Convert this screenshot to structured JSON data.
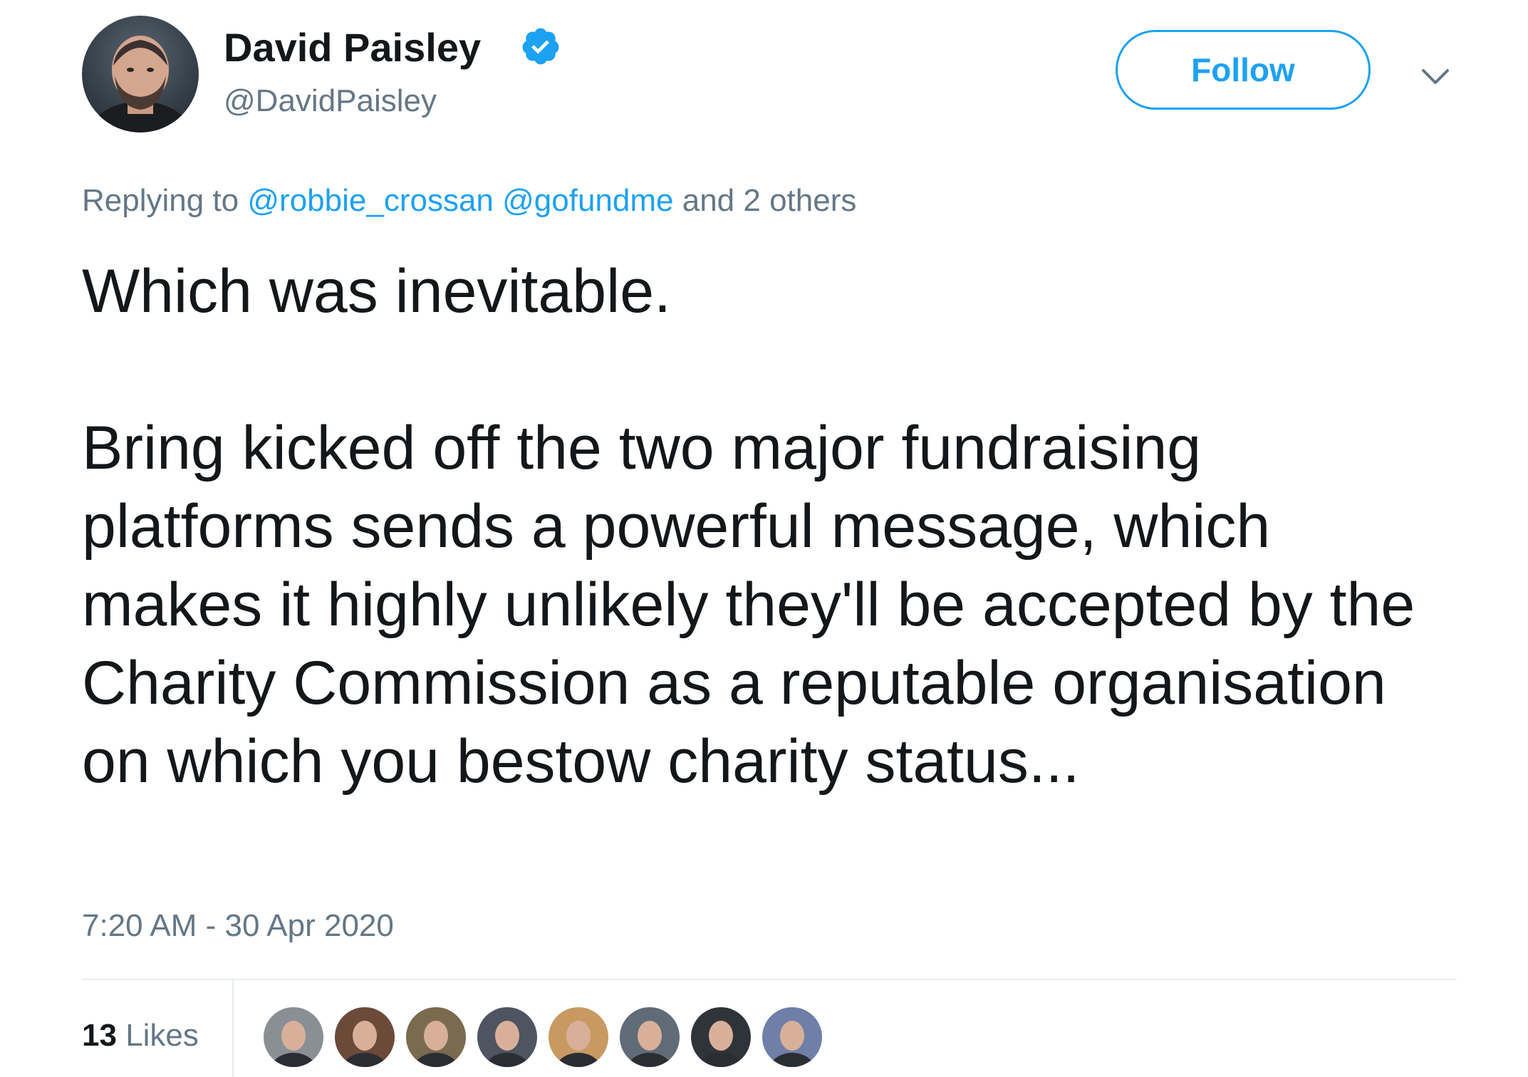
{
  "user": {
    "display_name": "David Paisley",
    "handle": "@DavidPaisley",
    "verified": true,
    "avatar_icon": "user-avatar"
  },
  "follow_label": "Follow",
  "menu_icon": "chevron-down-icon",
  "reply": {
    "prefix": "Replying to",
    "mentions": [
      "@robbie_crossan",
      "@gofundme"
    ],
    "suffix": "and 2 others"
  },
  "tweet": {
    "line1": "Which was inevitable.",
    "line2": "Bring kicked off the two major fundraising platforms sends a powerful message, which makes it highly unlikely they'll be accepted by the Charity Commission as a reputable organisation on which you bestow charity status..."
  },
  "timestamp": "7:20 AM - 30 Apr 2020",
  "likes": {
    "count": "13",
    "label": "Likes",
    "liker_avatar_colors": [
      "#8a8f96",
      "#6b4a3a",
      "#7a6a4e",
      "#4e5560",
      "#c89a62",
      "#5f6b76",
      "#2f343a",
      "#6f7fa8"
    ]
  },
  "colors": {
    "accent": "#1da1f2",
    "text": "#14171a",
    "secondary": "#657786",
    "divider": "#e6ecf0"
  }
}
